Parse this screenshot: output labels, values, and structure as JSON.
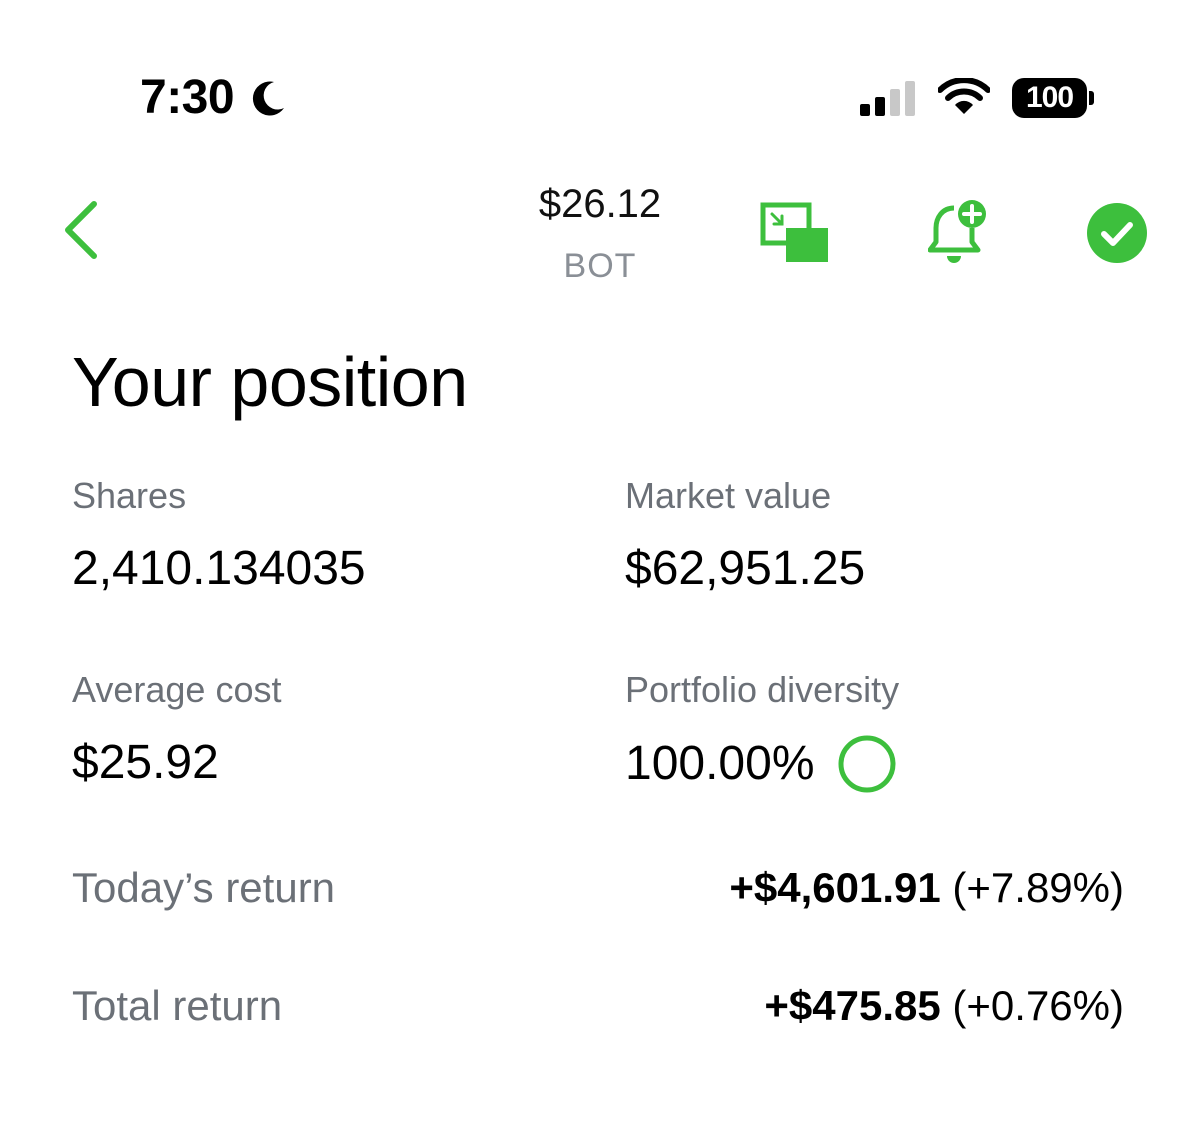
{
  "status_bar": {
    "time": "7:30",
    "moon_icon": "moon-icon",
    "signal_icon": "cellular-signal-icon",
    "wifi_icon": "wifi-icon",
    "battery_level": "100"
  },
  "header": {
    "price": "$26.12",
    "symbol": "BOT",
    "back_icon": "chevron-left-icon",
    "pip_icon": "picture-in-picture-icon",
    "alert_icon": "bell-plus-icon",
    "watch_icon": "check-circle-icon"
  },
  "position": {
    "title": "Your position",
    "shares_label": "Shares",
    "shares_value": "2,410.134035",
    "market_value_label": "Market value",
    "market_value": "$62,951.25",
    "avg_cost_label": "Average cost",
    "avg_cost_value": "$25.92",
    "diversity_label": "Portfolio diversity",
    "diversity_value": "100.00%",
    "diversity_fraction": 1.0,
    "todays_return_label": "Today’s return",
    "todays_return_amount": "+$4,601.91",
    "todays_return_pct": "(+7.89%)",
    "total_return_label": "Total return",
    "total_return_amount": "+$475.85",
    "total_return_pct": "(+0.76%)"
  },
  "colors": {
    "accent_green": "#3dbf3d",
    "label_gray": "#6b7077",
    "symbol_gray": "#8a8f96"
  }
}
